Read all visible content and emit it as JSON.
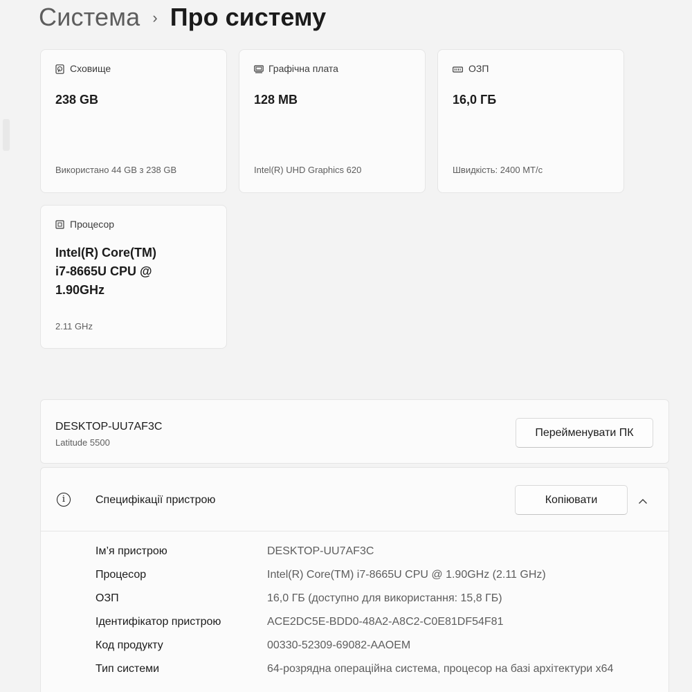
{
  "breadcrumb": {
    "parent": "Система",
    "separator": "›",
    "current": "Про систему"
  },
  "tiles": {
    "storage": {
      "icon": "storage-icon",
      "label": "Сховище",
      "value": "238 GB",
      "sub": "Використано 44 GB з 238 GB"
    },
    "graphics": {
      "icon": "graphics-card-icon",
      "label": "Графічна плата",
      "value": "128 MB",
      "sub": "Intel(R) UHD Graphics 620"
    },
    "ram": {
      "icon": "ram-icon",
      "label": "ОЗП",
      "value": "16,0 ГБ",
      "sub": "Швидкість: 2400 МТ/с"
    },
    "cpu": {
      "icon": "processor-icon",
      "label": "Процесор",
      "value_lines": [
        "Intel(R) Core(TM)",
        "i7-8665U CPU @",
        "1.90GHz"
      ],
      "sub": "2.11 GHz"
    }
  },
  "device": {
    "name": "DESKTOP-UU7AF3C",
    "model": "Latitude 5500",
    "rename_button": "Перейменувати ПК"
  },
  "specs": {
    "icon": "info-icon",
    "title": "Специфікації пристрою",
    "copy_button": "Копіювати",
    "chevron": "chevron-up-icon",
    "rows": [
      {
        "label": "Ім’я пристрою",
        "value": "DESKTOP-UU7AF3C"
      },
      {
        "label": "Процесор",
        "value": "Intel(R) Core(TM) i7-8665U CPU @ 1.90GHz (2.11 GHz)"
      },
      {
        "label": "ОЗП",
        "value": "16,0 ГБ (доступно для використання: 15,8 ГБ)"
      },
      {
        "label": "Ідентифікатор пристрою",
        "value": "ACE2DC5E-BDD0-48A2-A8C2-C0E81DF54F81"
      },
      {
        "label": "Код продукту",
        "value": "00330-52309-69082-AAOEM"
      },
      {
        "label": "Тип системи",
        "value": "64-розрядна операційна система, процесор на базі архітектури x64"
      }
    ]
  }
}
